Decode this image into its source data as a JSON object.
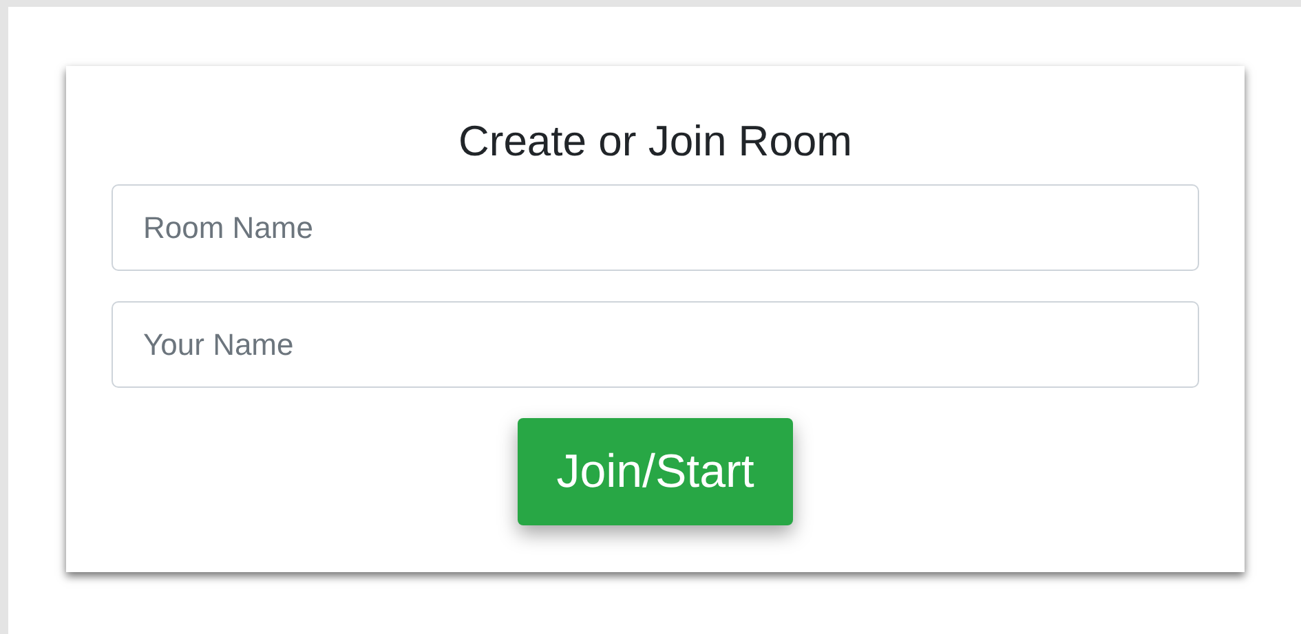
{
  "card": {
    "title": "Create or Join Room",
    "fields": [
      {
        "placeholder": "Room Name"
      },
      {
        "placeholder": "Your Name"
      }
    ],
    "button": "Join/Start"
  }
}
